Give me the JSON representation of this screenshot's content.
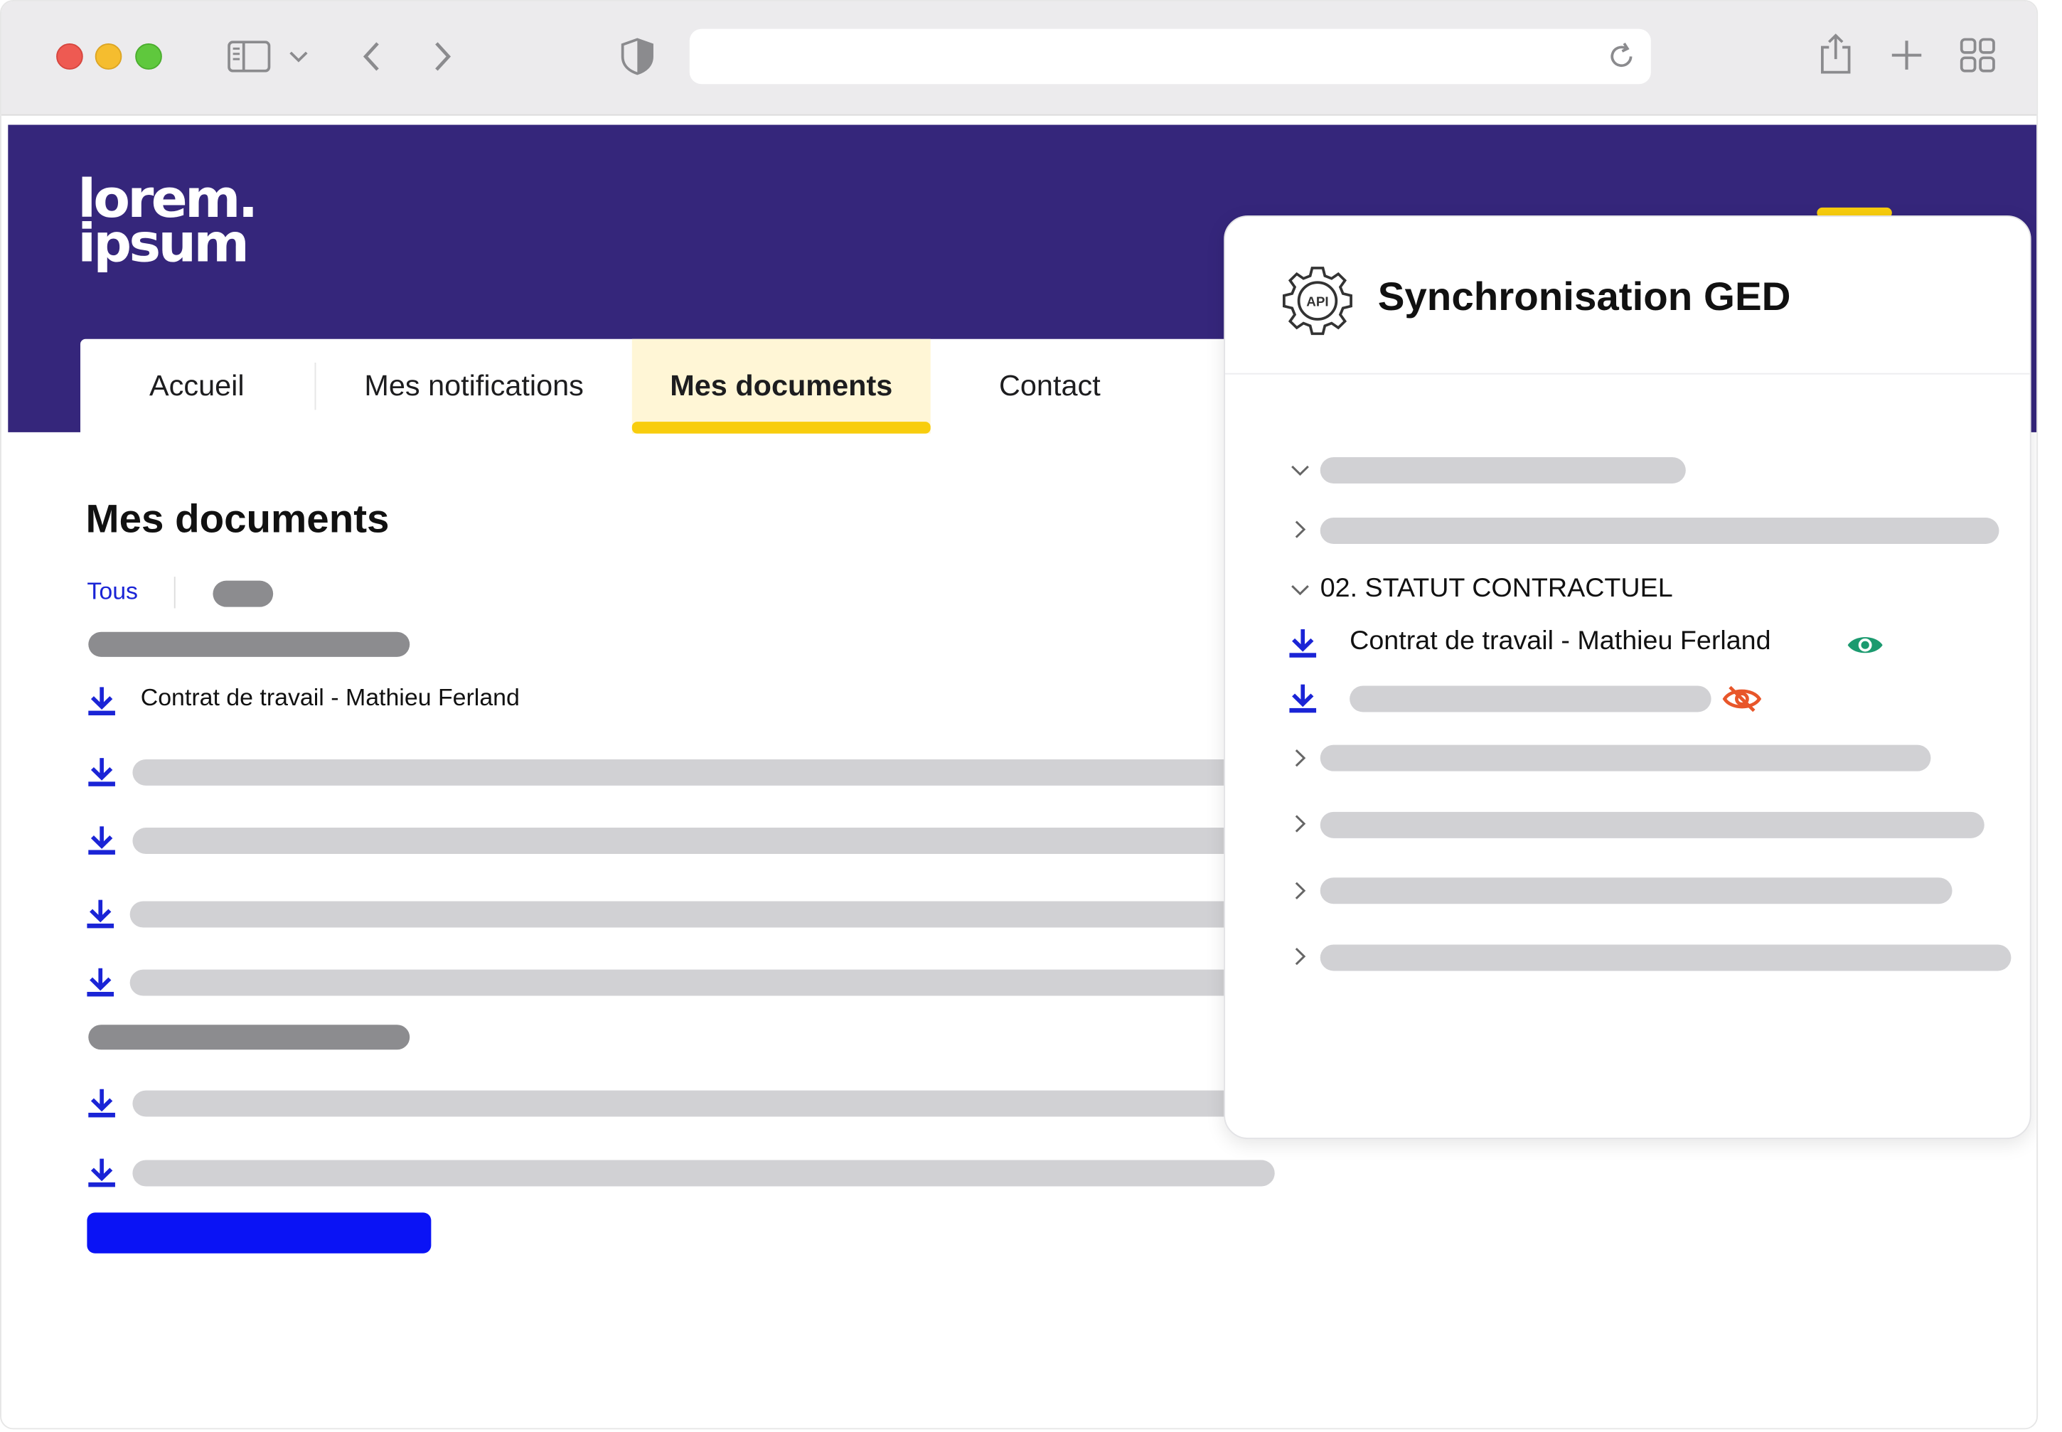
{
  "site": {
    "logo": "lorem.\nipsum"
  },
  "nav": {
    "items": [
      {
        "label": "Accueil",
        "active": false
      },
      {
        "label": "Mes notifications",
        "active": false
      },
      {
        "label": "Mes documents",
        "active": true
      },
      {
        "label": "Contact",
        "active": false
      }
    ]
  },
  "main": {
    "title": "Mes documents",
    "filter_all": "Tous",
    "document_label": "Contrat de travail - Mathieu Ferland"
  },
  "panel": {
    "title": "Synchronisation GED",
    "icon_label": "API",
    "section_title": "02. STATUT CONTRACTUEL",
    "document_label": "Contrat de travail - Mathieu Ferland",
    "visible_status": "visible",
    "hidden_status": "hidden"
  },
  "colors": {
    "brand": "#35267b",
    "accent": "#f8cd0d",
    "link": "#1a24d6",
    "cta": "#0a13f5",
    "visible": "#1b9a6f",
    "hidden": "#e8562a"
  },
  "icons": {
    "download": "download-icon",
    "visible": "eye-icon",
    "hidden": "eye-slash-icon",
    "api_gear": "api-gear-icon"
  }
}
